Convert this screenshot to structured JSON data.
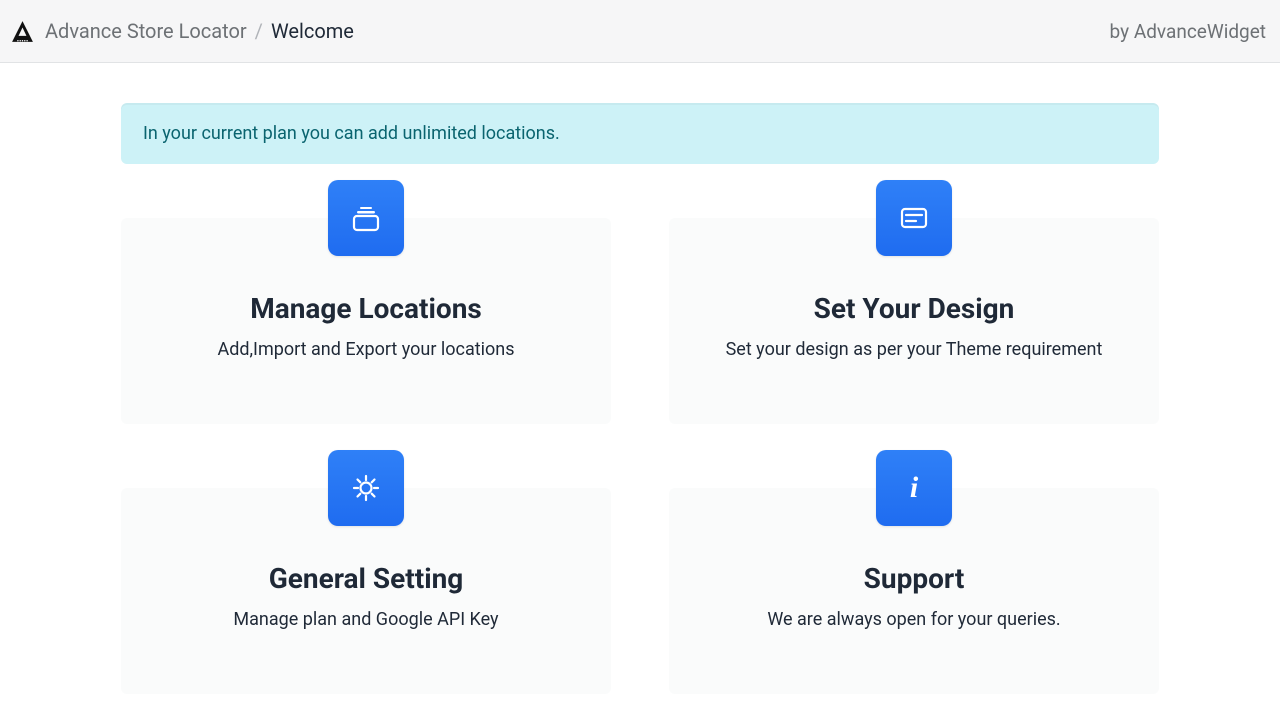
{
  "header": {
    "app_name": "Advance Store Locator",
    "separator": "/",
    "page_title": "Welcome",
    "byline": "by AdvanceWidget"
  },
  "alert": {
    "text": "In your current plan you can add unlimited locations."
  },
  "cards": [
    {
      "icon": "stack-icon",
      "title": "Manage Locations",
      "subtitle": "Add,Import and Export your locations"
    },
    {
      "icon": "form-icon",
      "title": "Set Your Design",
      "subtitle": "Set your design as per your Theme requirement"
    },
    {
      "icon": "gear-icon",
      "title": "General Setting",
      "subtitle": "Manage plan and Google API Key"
    },
    {
      "icon": "info-icon",
      "title": "Support",
      "subtitle": "We are always open for your queries."
    }
  ]
}
